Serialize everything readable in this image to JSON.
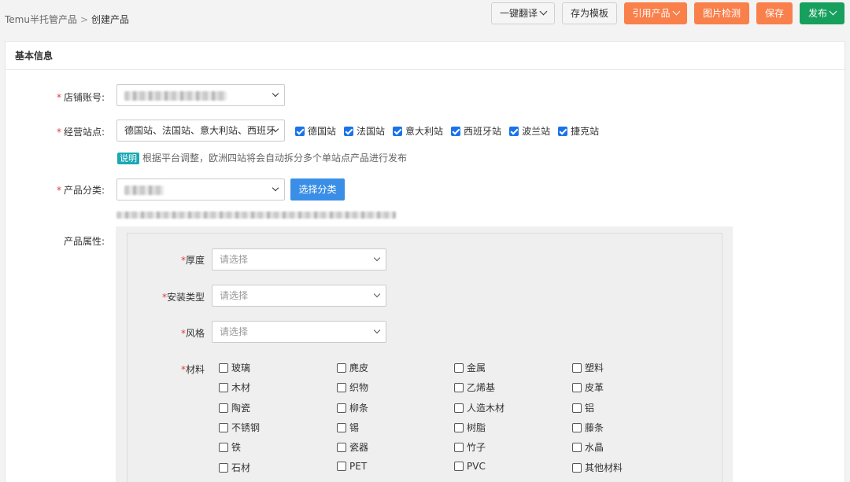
{
  "breadcrumb": {
    "parent": "Temu半托管产品",
    "separator": ">",
    "current": "创建产品"
  },
  "toolbar": {
    "translate": "一键翻译",
    "save_template": "存为模板",
    "quote_product": "引用产品",
    "image_check": "图片检测",
    "save": "保存",
    "publish": "发布"
  },
  "section": {
    "title": "基本信息"
  },
  "form": {
    "required_mark": "*",
    "shop_label": "店铺账号:",
    "sites_label": "经营站点:",
    "sites_value": "德国站、法国站、意大利站、西班牙",
    "sites": [
      "德国站",
      "法国站",
      "意大利站",
      "西班牙站",
      "波兰站",
      "捷克站"
    ],
    "note_badge": "说明",
    "note_text": "根据平台调整，欧洲四站将会自动拆分多个单站点产品进行发布",
    "category_label": "产品分类:",
    "choose_category": "选择分类",
    "attributes_label": "产品属性:"
  },
  "attributes": {
    "thickness": {
      "label": "厚度",
      "placeholder": "请选择"
    },
    "install_type": {
      "label": "安装类型",
      "placeholder": "请选择"
    },
    "style": {
      "label": "风格",
      "placeholder": "请选择"
    },
    "material": {
      "label": "材料",
      "options": [
        "玻璃",
        "麂皮",
        "金属",
        "塑料",
        "木材",
        "织物",
        "乙烯基",
        "皮革",
        "陶瓷",
        "柳条",
        "人造木材",
        "铝",
        "不锈钢",
        "锡",
        "树脂",
        "藤条",
        "铁",
        "瓷器",
        "竹子",
        "水晶",
        "石材",
        "PET",
        "PVC",
        "其他材料"
      ]
    }
  },
  "colors": {
    "orange": "#f97f4b",
    "green": "#17a05d",
    "blue": "#3a8ee6",
    "checkbox": "#1a73e8",
    "required": "#e4393c"
  }
}
